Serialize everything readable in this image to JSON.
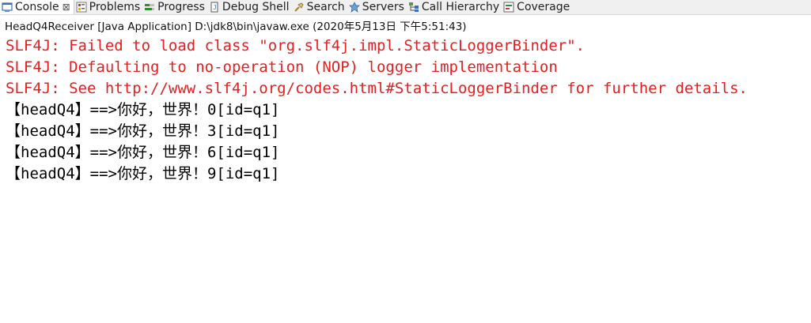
{
  "tabs": [
    {
      "label": "Console",
      "icon": "console-icon",
      "active": true,
      "closable": true
    },
    {
      "label": "Problems",
      "icon": "problems-icon",
      "active": false
    },
    {
      "label": "Progress",
      "icon": "progress-icon",
      "active": false
    },
    {
      "label": "Debug Shell",
      "icon": "debug-shell-icon",
      "active": false
    },
    {
      "label": "Search",
      "icon": "search-icon",
      "active": false
    },
    {
      "label": "Servers",
      "icon": "servers-icon",
      "active": false
    },
    {
      "label": "Call Hierarchy",
      "icon": "call-hierarchy-icon",
      "active": false
    },
    {
      "label": "Coverage",
      "icon": "coverage-icon",
      "active": false
    }
  ],
  "close_glyph": "⊠",
  "launch": {
    "text": "HeadQ4Receiver [Java Application] D:\\jdk8\\bin\\javaw.exe (2020年5月13日 下午5:51:43)"
  },
  "console_lines": [
    {
      "text": "SLF4J: Failed to load class \"org.slf4j.impl.StaticLoggerBinder\".",
      "kind": "err"
    },
    {
      "text": "SLF4J: Defaulting to no-operation (NOP) logger implementation",
      "kind": "err"
    },
    {
      "text": "SLF4J: See http://www.slf4j.org/codes.html#StaticLoggerBinder for further details.",
      "kind": "err"
    },
    {
      "text": "【headQ4】==>你好，世界！0[id=q1]",
      "kind": "out"
    },
    {
      "text": "【headQ4】==>你好，世界！3[id=q1]",
      "kind": "out"
    },
    {
      "text": "【headQ4】==>你好，世界！6[id=q1]",
      "kind": "out"
    },
    {
      "text": "【headQ4】==>你好，世界！9[id=q1]",
      "kind": "out"
    }
  ],
  "colors": {
    "stderr": "#e31f1f",
    "stdout": "#000000"
  }
}
